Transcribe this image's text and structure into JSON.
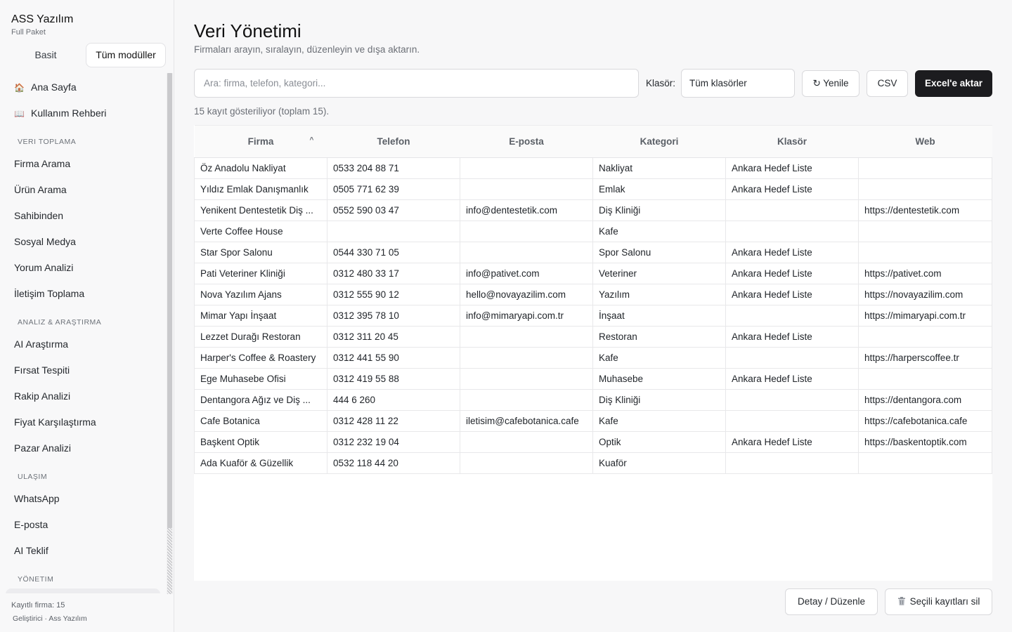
{
  "app": {
    "title": "ASS Yazılım",
    "plan": "Full Paket"
  },
  "mode_toggle": {
    "basic": "Basit",
    "all": "Tüm modüller"
  },
  "nav": {
    "home": {
      "label": "Ana Sayfa",
      "icon": "🏠"
    },
    "guide": {
      "label": "Kullanım Rehberi",
      "icon": "📖"
    },
    "sections": [
      {
        "title": "VERI TOPLAMA",
        "items": [
          "Firma Arama",
          "Ürün Arama",
          "Sahibinden",
          "Sosyal Medya",
          "Yorum Analizi",
          "İletişim Toplama"
        ]
      },
      {
        "title": "ANALIZ & ARAŞTIRMA",
        "items": [
          "AI Araştırma",
          "Fırsat Tespiti",
          "Rakip Analizi",
          "Fiyat Karşılaştırma",
          "Pazar Analizi"
        ]
      },
      {
        "title": "ULAŞIM",
        "items": [
          "WhatsApp",
          "E-posta",
          "AI Teklif"
        ]
      },
      {
        "title": "YÖNETIM",
        "items": []
      }
    ]
  },
  "footer": {
    "count": "Kayıtlı firma: 15",
    "developer": "Geliştirici · Ass Yazılım"
  },
  "page": {
    "title": "Veri Yönetimi",
    "subtitle": "Firmaları arayın, sıralayın, düzenleyin ve dışa aktarın."
  },
  "toolbar": {
    "search_placeholder": "Ara: firma, telefon, kategori...",
    "search_value": "",
    "folder_label": "Klasör:",
    "folder_value": "Tüm klasörler",
    "refresh": "↻ Yenile",
    "csv": "CSV",
    "excel": "Excel'e aktar"
  },
  "record_count": "15 kayıt gösteriliyor (toplam 15).",
  "table": {
    "headers": [
      "Firma",
      "Telefon",
      "E-posta",
      "Kategori",
      "Klasör",
      "Web"
    ],
    "sort_indicator": "^",
    "rows": [
      [
        "Öz Anadolu Nakliyat",
        "0533 204 88 71",
        "",
        "Nakliyat",
        "Ankara Hedef Liste",
        ""
      ],
      [
        "Yıldız Emlak Danışmanlık",
        "0505 771 62 39",
        "",
        "Emlak",
        "Ankara Hedef Liste",
        ""
      ],
      [
        "Yenikent Dentestetik Diş ...",
        "0552 590 03 47",
        "info@dentestetik.com",
        "Diş Kliniği",
        "",
        "https://dentestetik.com"
      ],
      [
        "Verte Coffee House",
        "",
        "",
        "Kafe",
        "",
        ""
      ],
      [
        "Star Spor Salonu",
        "0544 330 71 05",
        "",
        "Spor Salonu",
        "Ankara Hedef Liste",
        ""
      ],
      [
        "Pati Veteriner Kliniği",
        "0312 480 33 17",
        "info@pativet.com",
        "Veteriner",
        "Ankara Hedef Liste",
        "https://pativet.com"
      ],
      [
        "Nova Yazılım Ajans",
        "0312 555 90 12",
        "hello@novayazilim.com",
        "Yazılım",
        "Ankara Hedef Liste",
        "https://novayazilim.com"
      ],
      [
        "Mimar Yapı İnşaat",
        "0312 395 78 10",
        "info@mimaryapi.com.tr",
        "İnşaat",
        "",
        "https://mimaryapi.com.tr"
      ],
      [
        "Lezzet Durağı Restoran",
        "0312 311 20 45",
        "",
        "Restoran",
        "Ankara Hedef Liste",
        ""
      ],
      [
        "Harper's Coffee & Roastery",
        "0312 441 55 90",
        "",
        "Kafe",
        "",
        "https://harperscoffee.tr"
      ],
      [
        "Ege Muhasebe Ofisi",
        "0312 419 55 88",
        "",
        "Muhasebe",
        "Ankara Hedef Liste",
        ""
      ],
      [
        "Dentangora Ağız ve Diş ...",
        "444 6 260",
        "",
        "Diş Kliniği",
        "",
        "https://dentangora.com"
      ],
      [
        "Cafe Botanica",
        "0312 428 11 22",
        "iletisim@cafebotanica.cafe",
        "Kafe",
        "",
        "https://cafebotanica.cafe"
      ],
      [
        "Başkent Optik",
        "0312 232 19 04",
        "",
        "Optik",
        "Ankara Hedef Liste",
        "https://baskentoptik.com"
      ],
      [
        "Ada Kuaför & Güzellik",
        "0532 118 44 20",
        "",
        "Kuaför",
        "",
        ""
      ]
    ]
  },
  "actions": {
    "detail": "Detay / Düzenle",
    "delete": "Seçili kayıtları sil"
  }
}
